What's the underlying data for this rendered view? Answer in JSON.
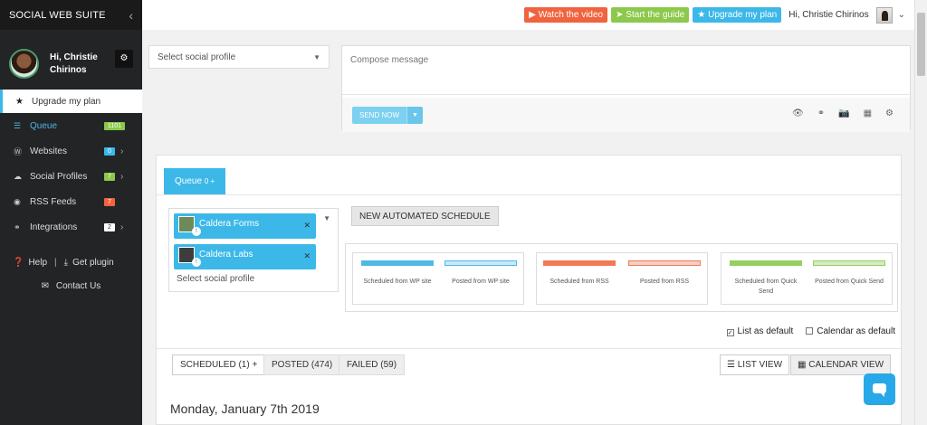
{
  "colors": {
    "sidebar_bg": "#222426",
    "accent": "#3cb8e8",
    "watch_video": "#f0633f",
    "start_guide": "#8cc84b",
    "upgrade_plan": "#3cb8e8",
    "badge_green": "#8cc84b",
    "badge_blue": "#3cb8e8",
    "badge_red": "#f0633f",
    "badge_white": "#ffffff"
  },
  "sidebar": {
    "brand": "SOCIAL WEB SUITE",
    "collapse_icon": "chevron-left-icon",
    "user_name": "Hi, Christie Chirinos",
    "upgrade_label": "Upgrade my plan",
    "items": [
      {
        "label": "Queue",
        "icon": "list-icon",
        "badge": "1101",
        "active": true,
        "has_submenu": false
      },
      {
        "label": "Websites",
        "icon": "wordpress-icon",
        "badge": "0",
        "active": false,
        "has_submenu": true
      },
      {
        "label": "Social Profiles",
        "icon": "cloud-icon",
        "badge": "7",
        "active": false,
        "has_submenu": true
      },
      {
        "label": "RSS Feeds",
        "icon": "rss-icon",
        "badge": "7",
        "active": false,
        "has_submenu": false
      },
      {
        "label": "Integrations",
        "icon": "link-icon",
        "badge": "2",
        "active": false,
        "has_submenu": true
      }
    ],
    "help_label": "Help",
    "get_plugin_label": "Get plugin",
    "contact_label": "Contact Us"
  },
  "topbar": {
    "watch_video": "Watch the video",
    "start_guide": "Start the guide",
    "upgrade_plan": "Upgrade my plan",
    "greeting": "Hi, Christie Chirinos"
  },
  "compose": {
    "profile_placeholder": "Select social profile",
    "message_placeholder": "Compose message",
    "send_label": "SEND NOW",
    "icons": [
      "eye-icon",
      "link-icon",
      "camera-icon",
      "calendar-icon",
      "gear-icon"
    ]
  },
  "queue": {
    "tab_label": "Queue",
    "tab_suffix": "0 +",
    "profiles": [
      {
        "name": "Caldera Forms"
      },
      {
        "name": "Caldera Labs"
      }
    ],
    "profiles_placeholder": "Select social profile",
    "automated_button": "NEW AUTOMATED SCHEDULE",
    "legend": [
      {
        "scheduled": "Scheduled from WP site",
        "posted": "Posted from WP site",
        "scheduled_color": "#4fb8e5",
        "posted_color": "#c9e8f6"
      },
      {
        "scheduled": "Scheduled from RSS",
        "posted": "Posted from RSS",
        "scheduled_color": "#f07a55",
        "posted_color": "#f2cfc2"
      },
      {
        "scheduled": "Scheduled from Quick Send",
        "posted": "Posted from Quick Send",
        "scheduled_color": "#95cf5f",
        "posted_color": "#d4eac0"
      }
    ],
    "list_default": "List as default",
    "calendar_default": "Calendar as default",
    "list_default_checked": true,
    "calendar_default_checked": false,
    "filters": {
      "scheduled": "SCHEDULED (1) +",
      "posted": "POSTED (474)",
      "failed": "FAILED (59)"
    },
    "views": {
      "list": "LIST VIEW",
      "calendar": "CALENDAR VIEW"
    },
    "date_heading": "Monday, January 7th 2019"
  }
}
